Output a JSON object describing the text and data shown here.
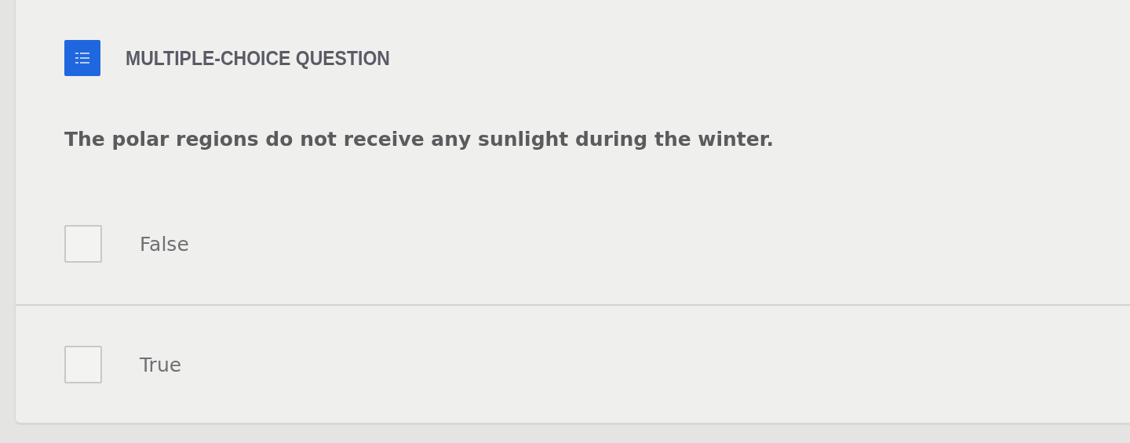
{
  "question": {
    "type_label": "MULTIPLE-CHOICE QUESTION",
    "text": "The polar regions do not receive any sunlight during the winter."
  },
  "options": [
    {
      "label": "False",
      "checked": false
    },
    {
      "label": "True",
      "checked": false
    }
  ]
}
